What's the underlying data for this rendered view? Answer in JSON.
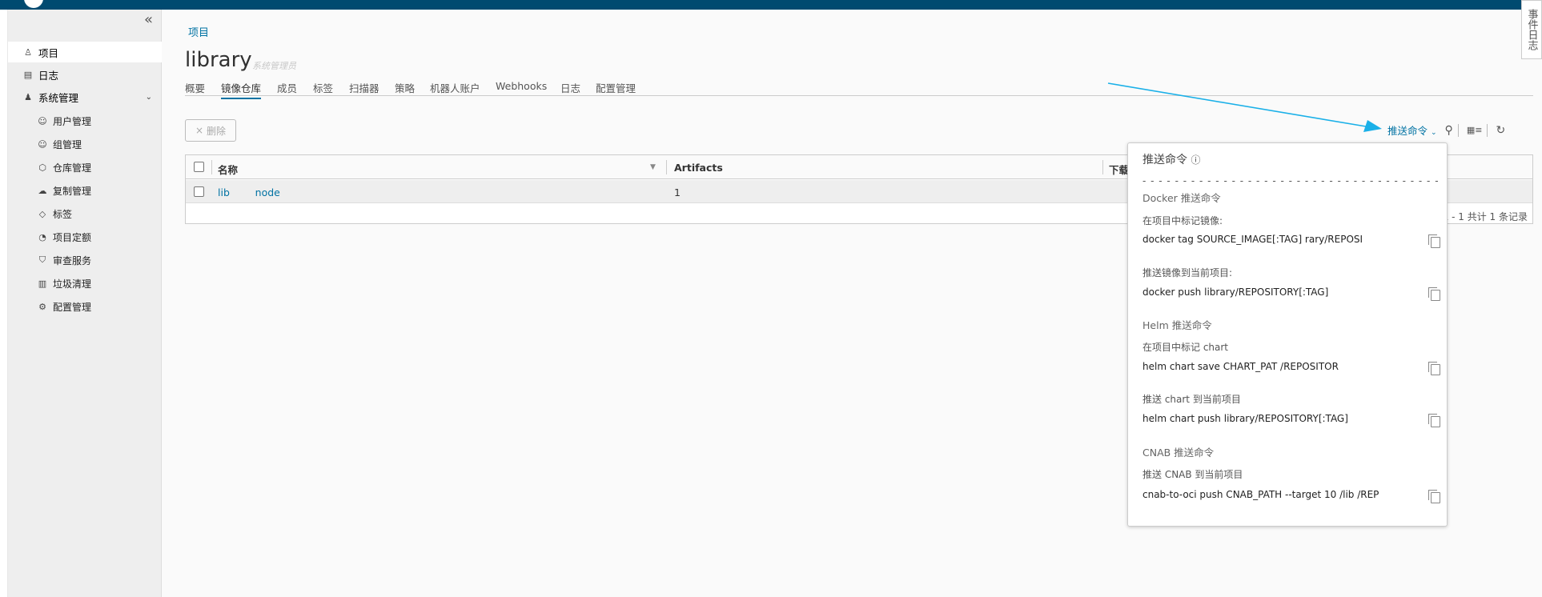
{
  "sidebar": {
    "collapse": "«",
    "items": [
      {
        "label": "项目",
        "icon": "project-icon",
        "glyph": "♙"
      },
      {
        "label": "日志",
        "icon": "log-icon",
        "glyph": "▤"
      },
      {
        "label": "系统管理",
        "icon": "admin-icon",
        "glyph": "♟",
        "chevron": "⌄"
      }
    ],
    "subitems": [
      {
        "label": "用户管理",
        "icon": "users-icon",
        "glyph": "☺"
      },
      {
        "label": "组管理",
        "icon": "group-icon",
        "glyph": "☺"
      },
      {
        "label": "仓库管理",
        "icon": "registry-icon",
        "glyph": "⬡"
      },
      {
        "label": "复制管理",
        "icon": "replication-icon",
        "glyph": "☁"
      },
      {
        "label": "标签",
        "icon": "tag-icon",
        "glyph": "◇"
      },
      {
        "label": "项目定额",
        "icon": "quota-icon",
        "glyph": "◔"
      },
      {
        "label": "审查服务",
        "icon": "shield-icon",
        "glyph": "⛉"
      },
      {
        "label": "垃圾清理",
        "icon": "trash-icon",
        "glyph": "▥"
      },
      {
        "label": "配置管理",
        "icon": "gear-icon",
        "glyph": "⚙"
      }
    ]
  },
  "main": {
    "breadcrumb": "项目",
    "title": "library",
    "role": "系统管理员",
    "tabs": [
      "概要",
      "镜像仓库",
      "成员",
      "标签",
      "扫描器",
      "策略",
      "机器人账户",
      "Webhooks",
      "日志",
      "配置管理"
    ],
    "active_tab": 1,
    "delete_label": "删除",
    "delete_icon": "×",
    "push_command": "推送命令",
    "push_chevron": "⌄"
  },
  "table": {
    "headers": [
      "名称",
      "Artifacts",
      "下载"
    ],
    "rows": [
      {
        "name": "lib        node",
        "artifacts": "1"
      }
    ],
    "pagination": "1 - 1 共计 1 条记录"
  },
  "popover": {
    "title": "推送命令",
    "info_icon": "ⓘ",
    "divider": "- - - - - - - - - - - - - - - - - - - - - - - - - - - - - - - - - - - - -",
    "sections": [
      {
        "heading": "Docker 推送命令"
      },
      {
        "heading": "Helm 推送命令"
      },
      {
        "heading": "CNAB 推送命令"
      }
    ],
    "commands": [
      {
        "label": "在项目中标记镜像:",
        "cmd": "docker tag SOURCE_IMAGE[:TAG]              rary/REPOSI"
      },
      {
        "label": "推送镜像到当前项目:",
        "cmd": "docker push              library/REPOSITORY[:TAG]"
      },
      {
        "label": "在项目中标记 chart",
        "cmd": "helm chart save CHART_PAT                   /REPOSITOR"
      },
      {
        "label": "推送 chart 到当前项目",
        "cmd": "helm chart push            library/REPOSITORY[:TAG]"
      },
      {
        "label": "推送 CNAB 到当前项目",
        "cmd": "cnab-to-oci push CNAB_PATH --target 10        /lib     /REP"
      }
    ]
  },
  "feedback": "事件日志"
}
